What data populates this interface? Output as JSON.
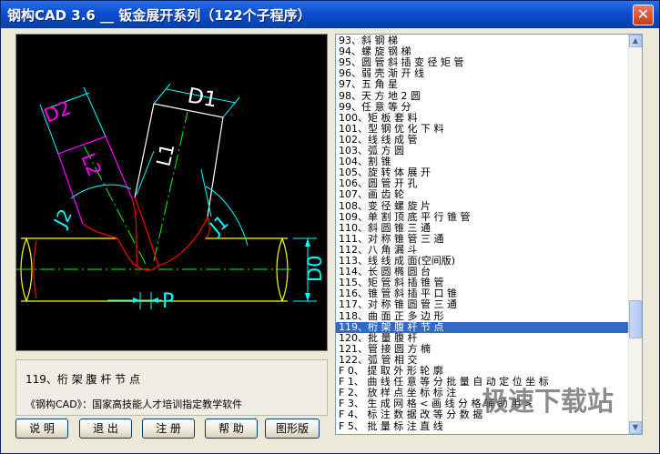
{
  "window": {
    "title": "钢构CAD 3.6 __ 钣金展开系列（122个子程序）",
    "close_symbol": "✕"
  },
  "drawing": {
    "labels": {
      "d1": "D1",
      "d2": "D2",
      "l1": "L1",
      "l2": "L2",
      "j1": "J1",
      "j2": "J2",
      "d0": "D0",
      "p": "P"
    },
    "colors": {
      "background": "#000000",
      "main_pipe": "#ffff00",
      "branch_right": "#ffffff",
      "branch_left": "#ff00ff",
      "cut_curve": "#ff0000",
      "dimension": "#00ffff",
      "centerline": "#00ff00"
    }
  },
  "caption": {
    "selected_name": "119、桁 架 腹 杆 节 点",
    "software_note": "《钢构CAD》：国家高技能人才培训指定教学软件"
  },
  "buttons": [
    "说  明",
    "退  出",
    "注  册",
    "帮  助",
    "图形版"
  ],
  "list": {
    "selected_index": 26,
    "items": [
      "93、斜 钢 梯",
      "94、螺 旋 钢 梯",
      "95、圆 管 斜 插 变 径 矩 管",
      "96、弱 壳 渐 开 线",
      "97、五 角 星",
      "98、天 方 地 2 圆",
      "99、任 意 等 分",
      "100、矩 板 套 料",
      "101、型 钢 优 化 下 料",
      "102、线 线 成 管",
      "103、弧 方 圆",
      "104、割 锥",
      "105、旋 转 体 展 开",
      "106、圆 管 开 孔",
      "107、画 齿 轮",
      "108、变 径 螺 旋 片",
      "109、单 割 顶 底 平 行 锥 管",
      "110、斜 圆 锥 三 通",
      "111、对 称 锥 管 三 通",
      "112、八 角 漏 斗",
      "113、线 线 成 面(空间版)",
      "114、长 圆 椭 圆 台",
      "115、矩 管 斜 插 锥 管",
      "116、锥 管 斜 插 平 口 锥",
      "117、对 称 锥 圆 管 三 通",
      "118、曲 面 正 多 边 形",
      "119、桁 架 腹 杆 节 点",
      "120、批 量 腹 杆",
      "121、管 接 圆 方 楠",
      "122、弧 管 相 交",
      "F 0、 提 取 外 形 轮 廓",
      "F 1、 曲 线 任 意 等 分 批 量 自 动 定 位 坐 标",
      "F 2、 放 样 点 坐 标 标 注",
      "F 3、 生 成 网 格 < 画 线 分 格 辅 助 用 >",
      "F 4、 标 注 数 据 改 等 分 数 据",
      "F 5、 批 量 标 注 直 线"
    ]
  },
  "scrollbar": {
    "up_arrow": "▲",
    "down_arrow": "▼"
  },
  "watermark": "极速下载站"
}
